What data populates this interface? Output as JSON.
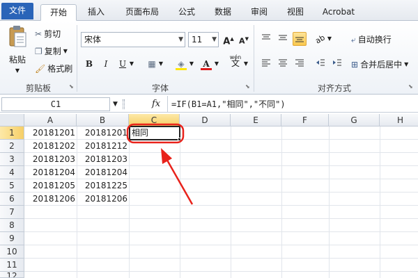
{
  "ribbon_tabs": [
    "文件",
    "开始",
    "插入",
    "页面布局",
    "公式",
    "数据",
    "审阅",
    "视图",
    "Acrobat"
  ],
  "clipboard": {
    "paste": "粘贴",
    "cut": "剪切",
    "copy": "复制",
    "format_painter": "格式刷",
    "group_label": "剪贴板"
  },
  "font": {
    "name": "宋体",
    "size": "11",
    "bold": "B",
    "italic": "I",
    "underline": "U",
    "font_color_glyph": "A",
    "phonetic_glyph": "wén",
    "group_label": "字体"
  },
  "alignment": {
    "wrap_text": "自动换行",
    "merge_center": "合并后居中",
    "group_label": "对齐方式"
  },
  "formula_bar": {
    "name_box": "C1",
    "fx": "fx",
    "formula": "=IF(B1=A1,\"相同\",\"不同\")"
  },
  "grid": {
    "columns": [
      "A",
      "B",
      "C",
      "D",
      "E",
      "F",
      "G",
      "H"
    ],
    "rows": [
      "1",
      "2",
      "3",
      "4",
      "5",
      "6",
      "7",
      "8",
      "9",
      "10",
      "11",
      "12"
    ],
    "data": [
      [
        "20181201",
        "20181201",
        "相同"
      ],
      [
        "20181202",
        "20181212",
        ""
      ],
      [
        "20181203",
        "20181203",
        ""
      ],
      [
        "20181204",
        "20181204",
        ""
      ],
      [
        "20181205",
        "20181225",
        ""
      ],
      [
        "20181206",
        "20181206",
        ""
      ]
    ],
    "selected_cell": "C1"
  },
  "colors": {
    "file_tab": "#2a64b8",
    "annotation": "#e8221b",
    "selection_header": "#f6cf67"
  }
}
